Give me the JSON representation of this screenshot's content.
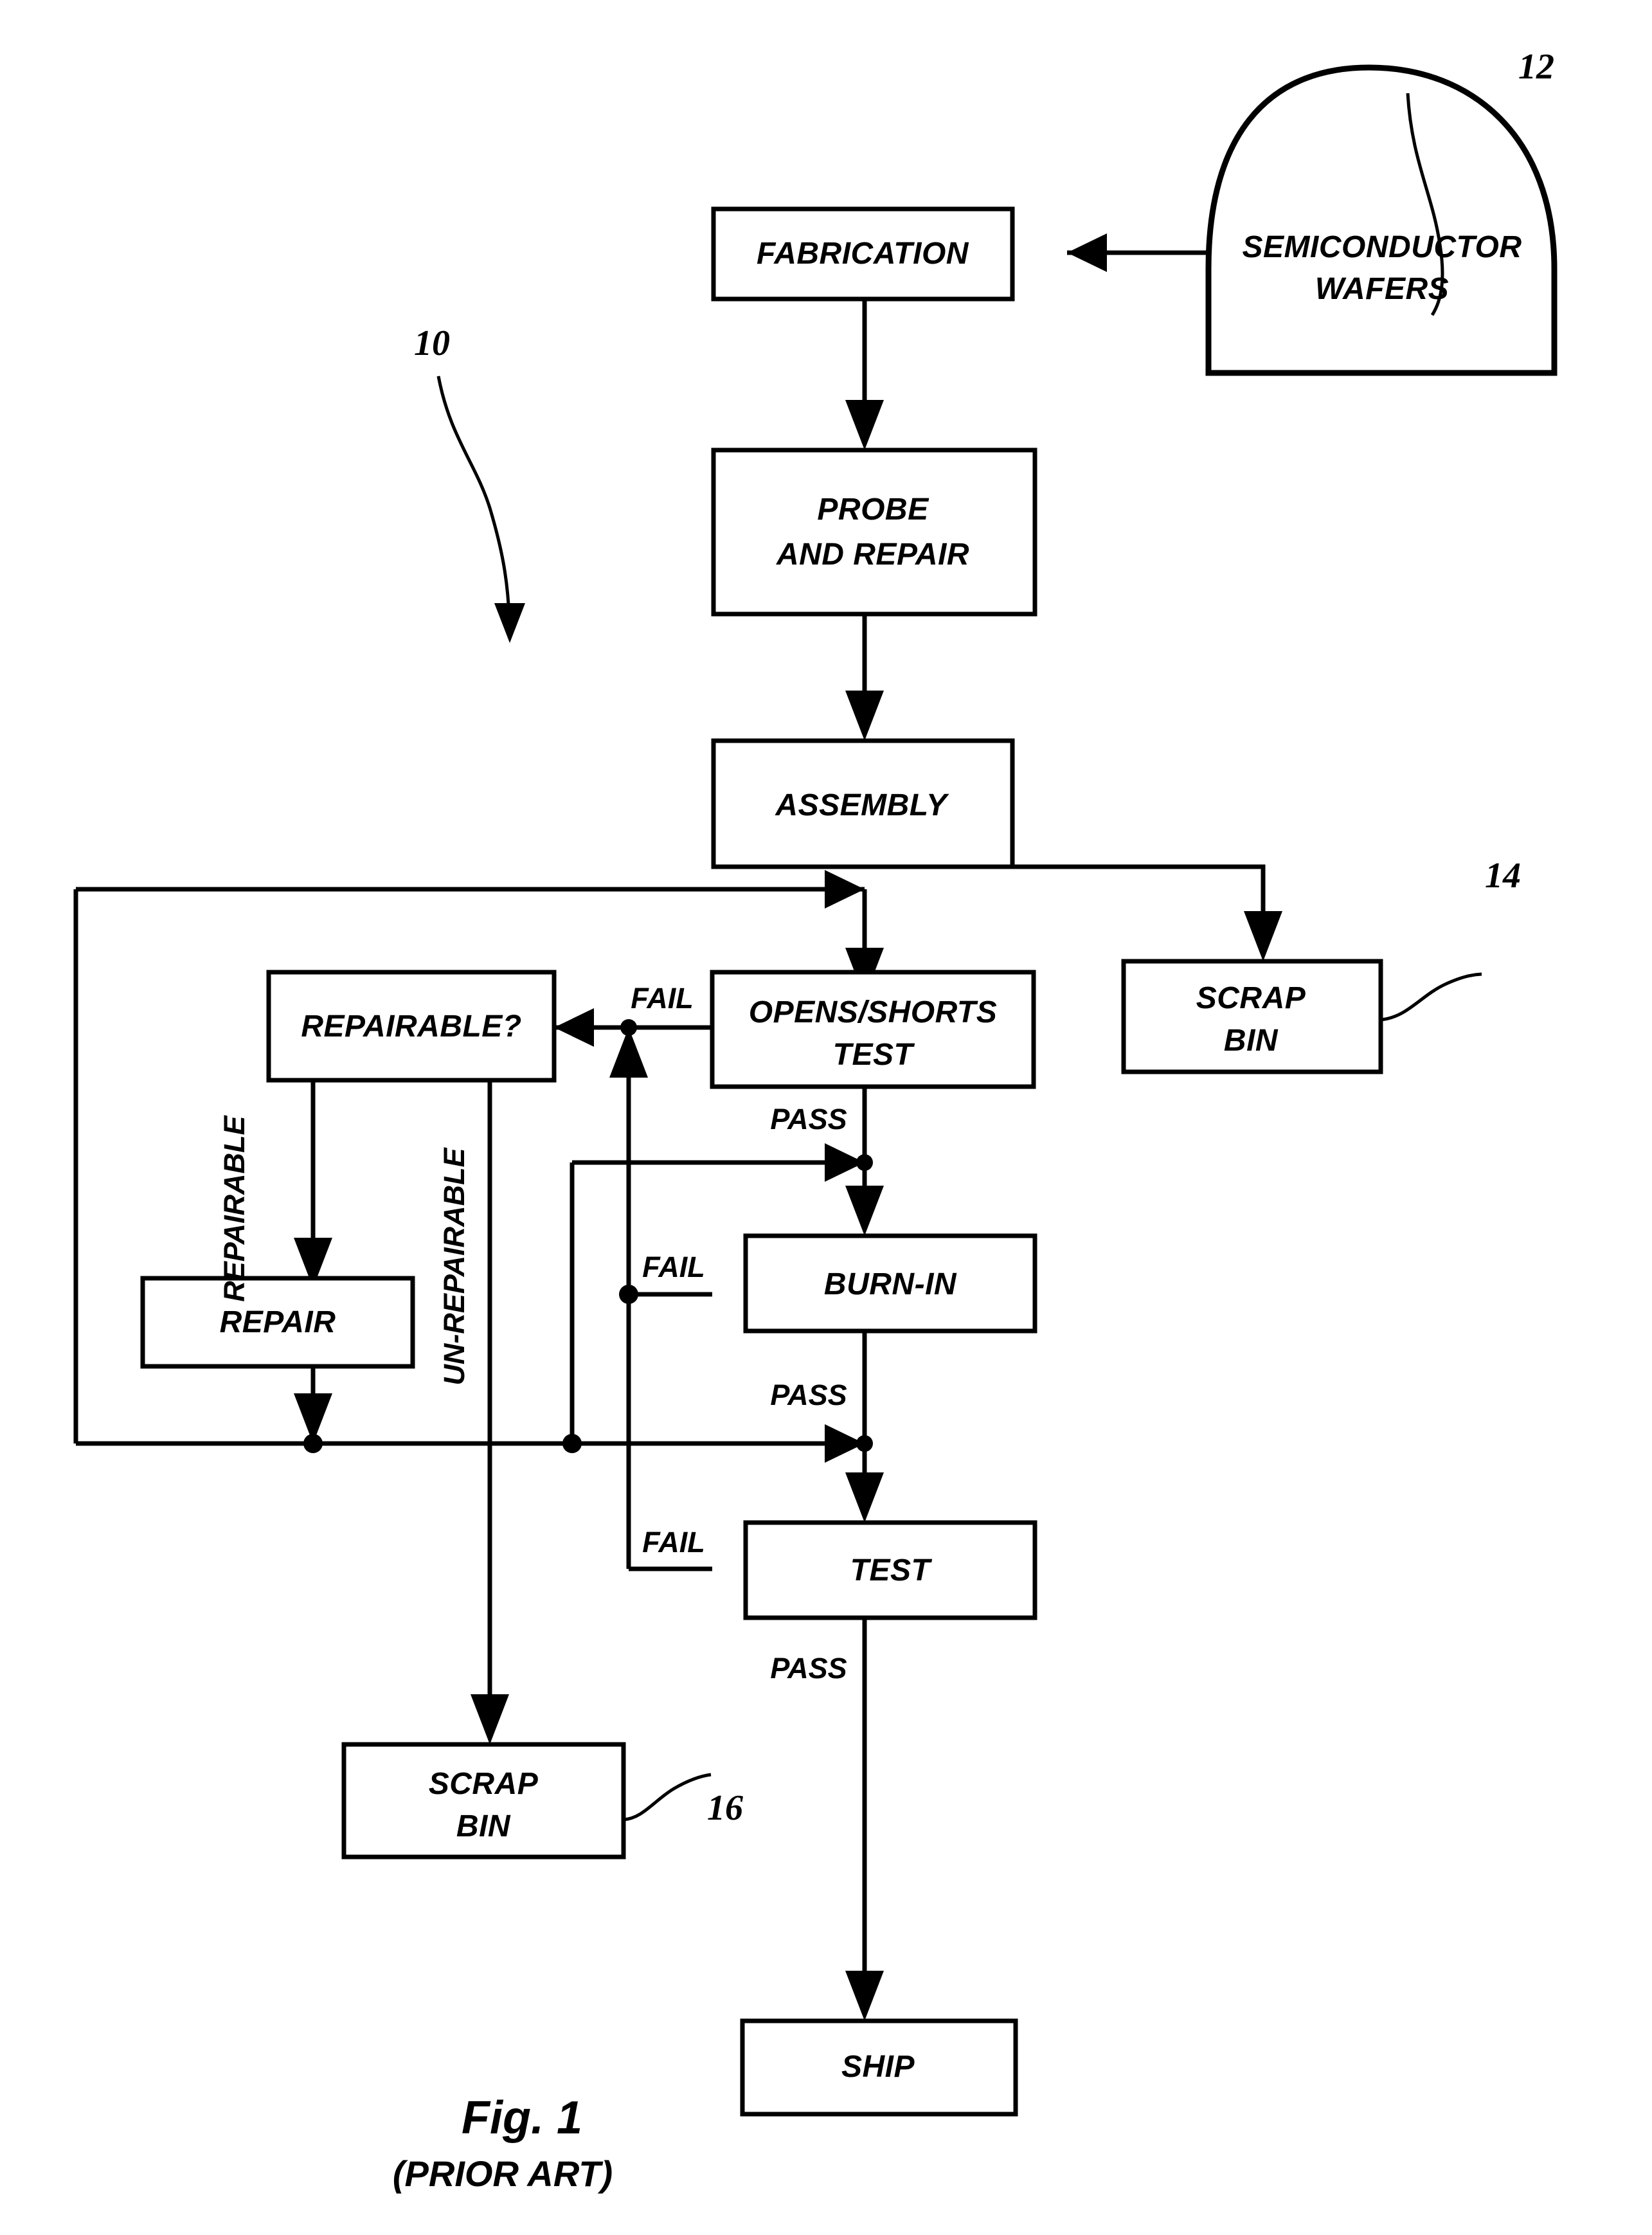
{
  "figure": {
    "caption_main": "Fig. 1",
    "caption_sub": "(PRIOR ART)"
  },
  "nodes": {
    "wafers": "SEMICONDUCTOR\nWAFERS",
    "wafers_line1": "SEMICONDUCTOR",
    "wafers_line2": "WAFERS",
    "fabrication": "FABRICATION",
    "probe_line1": "PROBE",
    "probe_line2": "AND REPAIR",
    "assembly": "ASSEMBLY",
    "scrap_bin_top_line1": "SCRAP",
    "scrap_bin_top_line2": "BIN",
    "opens_shorts_line1": "OPENS/SHORTS",
    "opens_shorts_line2": "TEST",
    "repairable_q": "REPAIRABLE?",
    "repair": "REPAIR",
    "burn_in": "BURN-IN",
    "test": "TEST",
    "scrap_bin_bottom_line1": "SCRAP",
    "scrap_bin_bottom_line2": "BIN",
    "ship": "SHIP"
  },
  "edge_labels": {
    "fail_opens_shorts": "FAIL",
    "pass_opens_shorts": "PASS",
    "fail_burn_in": "FAIL",
    "pass_burn_in": "PASS",
    "fail_test": "FAIL",
    "pass_test": "PASS",
    "repairable": "REPAIRABLE",
    "un_repairable": "UN-REPAIRABLE"
  },
  "reference_numerals": {
    "process": "10",
    "wafers": "12",
    "scrap_bin_top": "14",
    "scrap_bin_bottom": "16"
  },
  "colors": {
    "ink": "#000000",
    "paper": "#ffffff"
  }
}
